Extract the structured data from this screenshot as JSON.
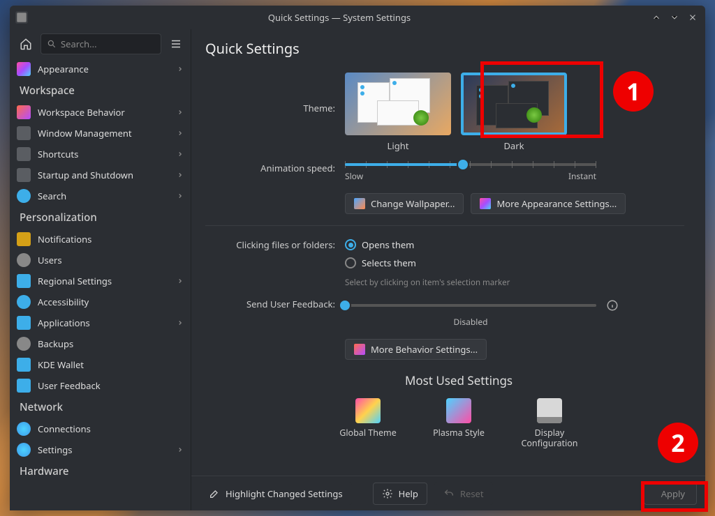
{
  "window": {
    "title": "Quick Settings — System Settings"
  },
  "sidebar": {
    "search_placeholder": "Search...",
    "items": [
      {
        "kind": "item",
        "label": "Appearance",
        "icon": "ic-appear",
        "chev": true
      },
      {
        "kind": "section",
        "label": "Workspace"
      },
      {
        "kind": "item",
        "label": "Workspace Behavior",
        "icon": "ic-wb",
        "chev": true
      },
      {
        "kind": "item",
        "label": "Window Management",
        "icon": "ic-wm",
        "chev": true
      },
      {
        "kind": "item",
        "label": "Shortcuts",
        "icon": "ic-sc",
        "chev": true
      },
      {
        "kind": "item",
        "label": "Startup and Shutdown",
        "icon": "ic-ss",
        "chev": true
      },
      {
        "kind": "item",
        "label": "Search",
        "icon": "ic-se",
        "chev": true
      },
      {
        "kind": "section",
        "label": "Personalization"
      },
      {
        "kind": "item",
        "label": "Notifications",
        "icon": "ic-notif",
        "chev": false
      },
      {
        "kind": "item",
        "label": "Users",
        "icon": "ic-users",
        "chev": false
      },
      {
        "kind": "item",
        "label": "Regional Settings",
        "icon": "ic-reg",
        "chev": true
      },
      {
        "kind": "item",
        "label": "Accessibility",
        "icon": "ic-acc",
        "chev": false
      },
      {
        "kind": "item",
        "label": "Applications",
        "icon": "ic-apps",
        "chev": true
      },
      {
        "kind": "item",
        "label": "Backups",
        "icon": "ic-back",
        "chev": false
      },
      {
        "kind": "item",
        "label": "KDE Wallet",
        "icon": "ic-wallet",
        "chev": false
      },
      {
        "kind": "item",
        "label": "User Feedback",
        "icon": "ic-uf",
        "chev": false
      },
      {
        "kind": "section",
        "label": "Network"
      },
      {
        "kind": "item",
        "label": "Connections",
        "icon": "ic-conn",
        "chev": false
      },
      {
        "kind": "item",
        "label": "Settings",
        "icon": "ic-set",
        "chev": true
      },
      {
        "kind": "section",
        "label": "Hardware"
      }
    ]
  },
  "content": {
    "heading": "Quick Settings",
    "theme": {
      "label": "Theme:",
      "light": "Light",
      "dark": "Dark",
      "selected": "dark"
    },
    "animation": {
      "label": "Animation speed:",
      "slow": "Slow",
      "instant": "Instant",
      "value_percent": 47
    },
    "buttons": {
      "change_wallpaper": "Change Wallpaper...",
      "more_appearance": "More Appearance Settings..."
    },
    "clicking": {
      "label": "Clicking files or folders:",
      "opens": "Opens them",
      "selects": "Selects them",
      "hint": "Select by clicking on item's selection marker",
      "selected": "opens"
    },
    "feedback": {
      "label": "Send User Feedback:",
      "disabled": "Disabled",
      "value_percent": 0
    },
    "more_behavior": "More Behavior Settings...",
    "most_used": {
      "heading": "Most Used Settings",
      "items": [
        {
          "label": "Global Theme",
          "icon": "mu-gt"
        },
        {
          "label": "Plasma Style",
          "icon": "mu-ps"
        },
        {
          "label": "Display Configuration",
          "icon": "mu-dc"
        }
      ]
    }
  },
  "footer": {
    "highlight": "Highlight Changed Settings",
    "help": "Help",
    "reset": "Reset",
    "apply": "Apply"
  },
  "annotations": {
    "1": "1",
    "2": "2"
  }
}
